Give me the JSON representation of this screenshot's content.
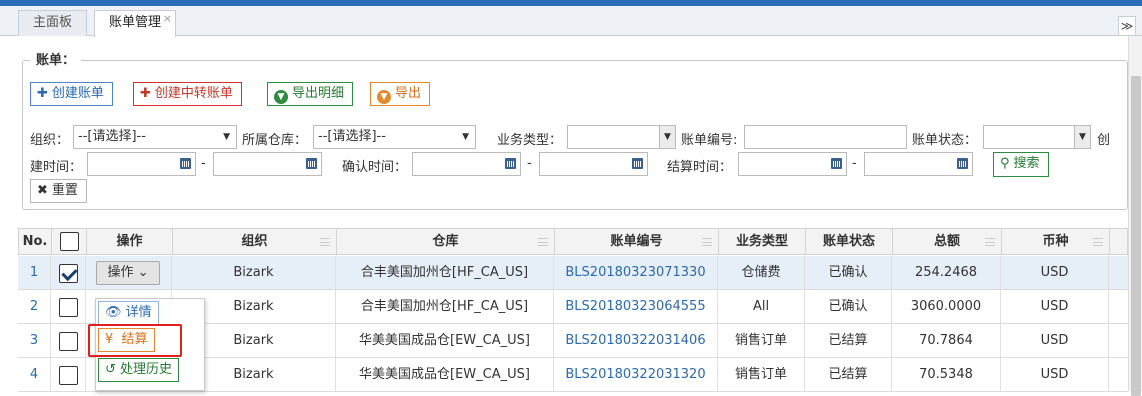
{
  "tabs": [
    {
      "label": "主面板"
    },
    {
      "label": "账单管理",
      "close": "×"
    }
  ],
  "tab_menu": "≫",
  "panel": {
    "legend": "账单："
  },
  "actions": {
    "create_bill": "创建账单",
    "create_transfer_bill": "创建中转账单",
    "export_detail": "导出明细",
    "export": "导出"
  },
  "filters": {
    "org_label": "组织：",
    "org_value": "--[请选择]--",
    "warehouse_label": "所属仓库：",
    "warehouse_value": "--[请选择]--",
    "biz_type_label": "业务类型：",
    "bill_no_label": "账单编号:",
    "bill_status_label": "账单状态：",
    "create_time_label_a": "创",
    "create_time_label_b": "建时间：",
    "confirm_time_label": "确认时间：",
    "settle_time_label": "结算时间：",
    "range_sep": "-",
    "search_button": "搜索",
    "reset_button": "重置"
  },
  "table": {
    "headers": [
      "No.",
      "",
      "操作",
      "组织",
      "仓库",
      "账单编号",
      "业务类型",
      "账单状态",
      "总额",
      "币种"
    ],
    "op_button": "操作",
    "rows": [
      {
        "no": "1",
        "checked": true,
        "org": "Bizark",
        "warehouse": "合丰美国加州仓[HF_CA_US]",
        "bill_no": "BLS20180323071330",
        "biz_type": "仓储费",
        "status": "已确认",
        "total": "254.2468",
        "currency": "USD"
      },
      {
        "no": "2",
        "checked": false,
        "org": "Bizark",
        "warehouse": "合丰美国加州仓[HF_CA_US]",
        "bill_no": "BLS20180323064555",
        "biz_type": "All",
        "status": "已确认",
        "total": "3060.0000",
        "currency": "USD"
      },
      {
        "no": "3",
        "checked": false,
        "org": "Bizark",
        "warehouse": "华美美国成品仓[EW_CA_US]",
        "bill_no": "BLS20180322031406",
        "biz_type": "销售订单",
        "status": "已结算",
        "total": "70.7864",
        "currency": "USD"
      },
      {
        "no": "4",
        "checked": false,
        "org": "Bizark",
        "warehouse": "华美美国成品仓[EW_CA_US]",
        "bill_no": "BLS20180322031320",
        "biz_type": "销售订单",
        "status": "已结算",
        "total": "70.5348",
        "currency": "USD"
      }
    ]
  },
  "op_menu": {
    "detail": "详情",
    "settle": "结算",
    "history": "处理历史"
  }
}
